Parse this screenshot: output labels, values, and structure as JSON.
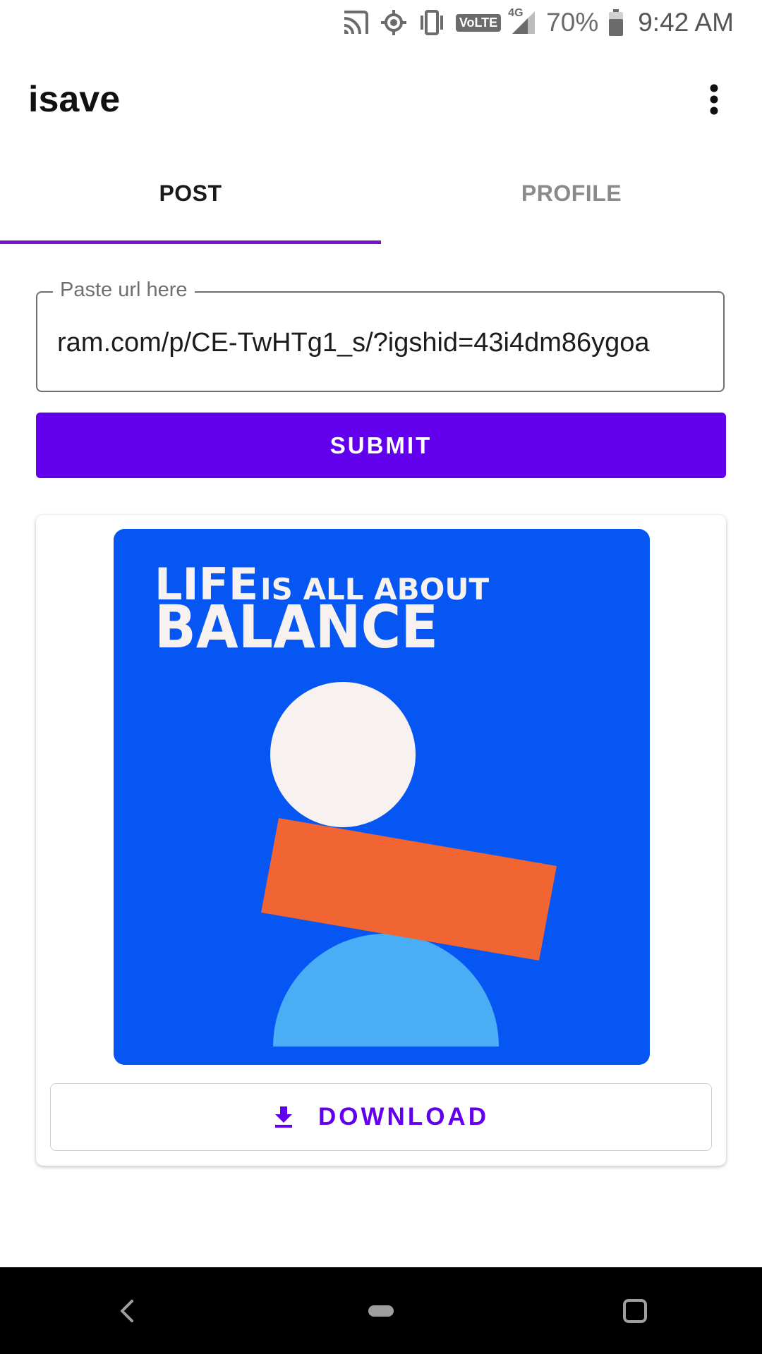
{
  "status_bar": {
    "volte": "VoLTE",
    "network": "4G",
    "battery": "70%",
    "time": "9:42 AM",
    "icons": [
      "cast-icon",
      "location-icon",
      "vibrate-icon",
      "volte-icon",
      "signal-icon",
      "battery-icon"
    ]
  },
  "app_bar": {
    "title": "isave",
    "menu_icon": "more-vert-icon"
  },
  "tabs": [
    {
      "label": "POST",
      "active": true
    },
    {
      "label": "PROFILE",
      "active": false
    }
  ],
  "url_field": {
    "label": "Paste url here",
    "value": "ram.com/p/CE-TwHTg1_s/?igshid=43i4dm86ygoa"
  },
  "submit_label": "SUBMIT",
  "post": {
    "image_text_line1_big": "LIFE",
    "image_text_line1_small": "IS ALL ABOUT",
    "image_text_line2": "BALANCE"
  },
  "download": {
    "label": "DOWNLOAD",
    "icon": "download-icon"
  },
  "colors": {
    "accent": "#6200ee",
    "tab_indicator": "#7a12c9",
    "image_bg": "#0556f3",
    "image_circle": "#f7f1ef",
    "image_bar": "#f06532",
    "image_dome": "#4aaef7"
  }
}
